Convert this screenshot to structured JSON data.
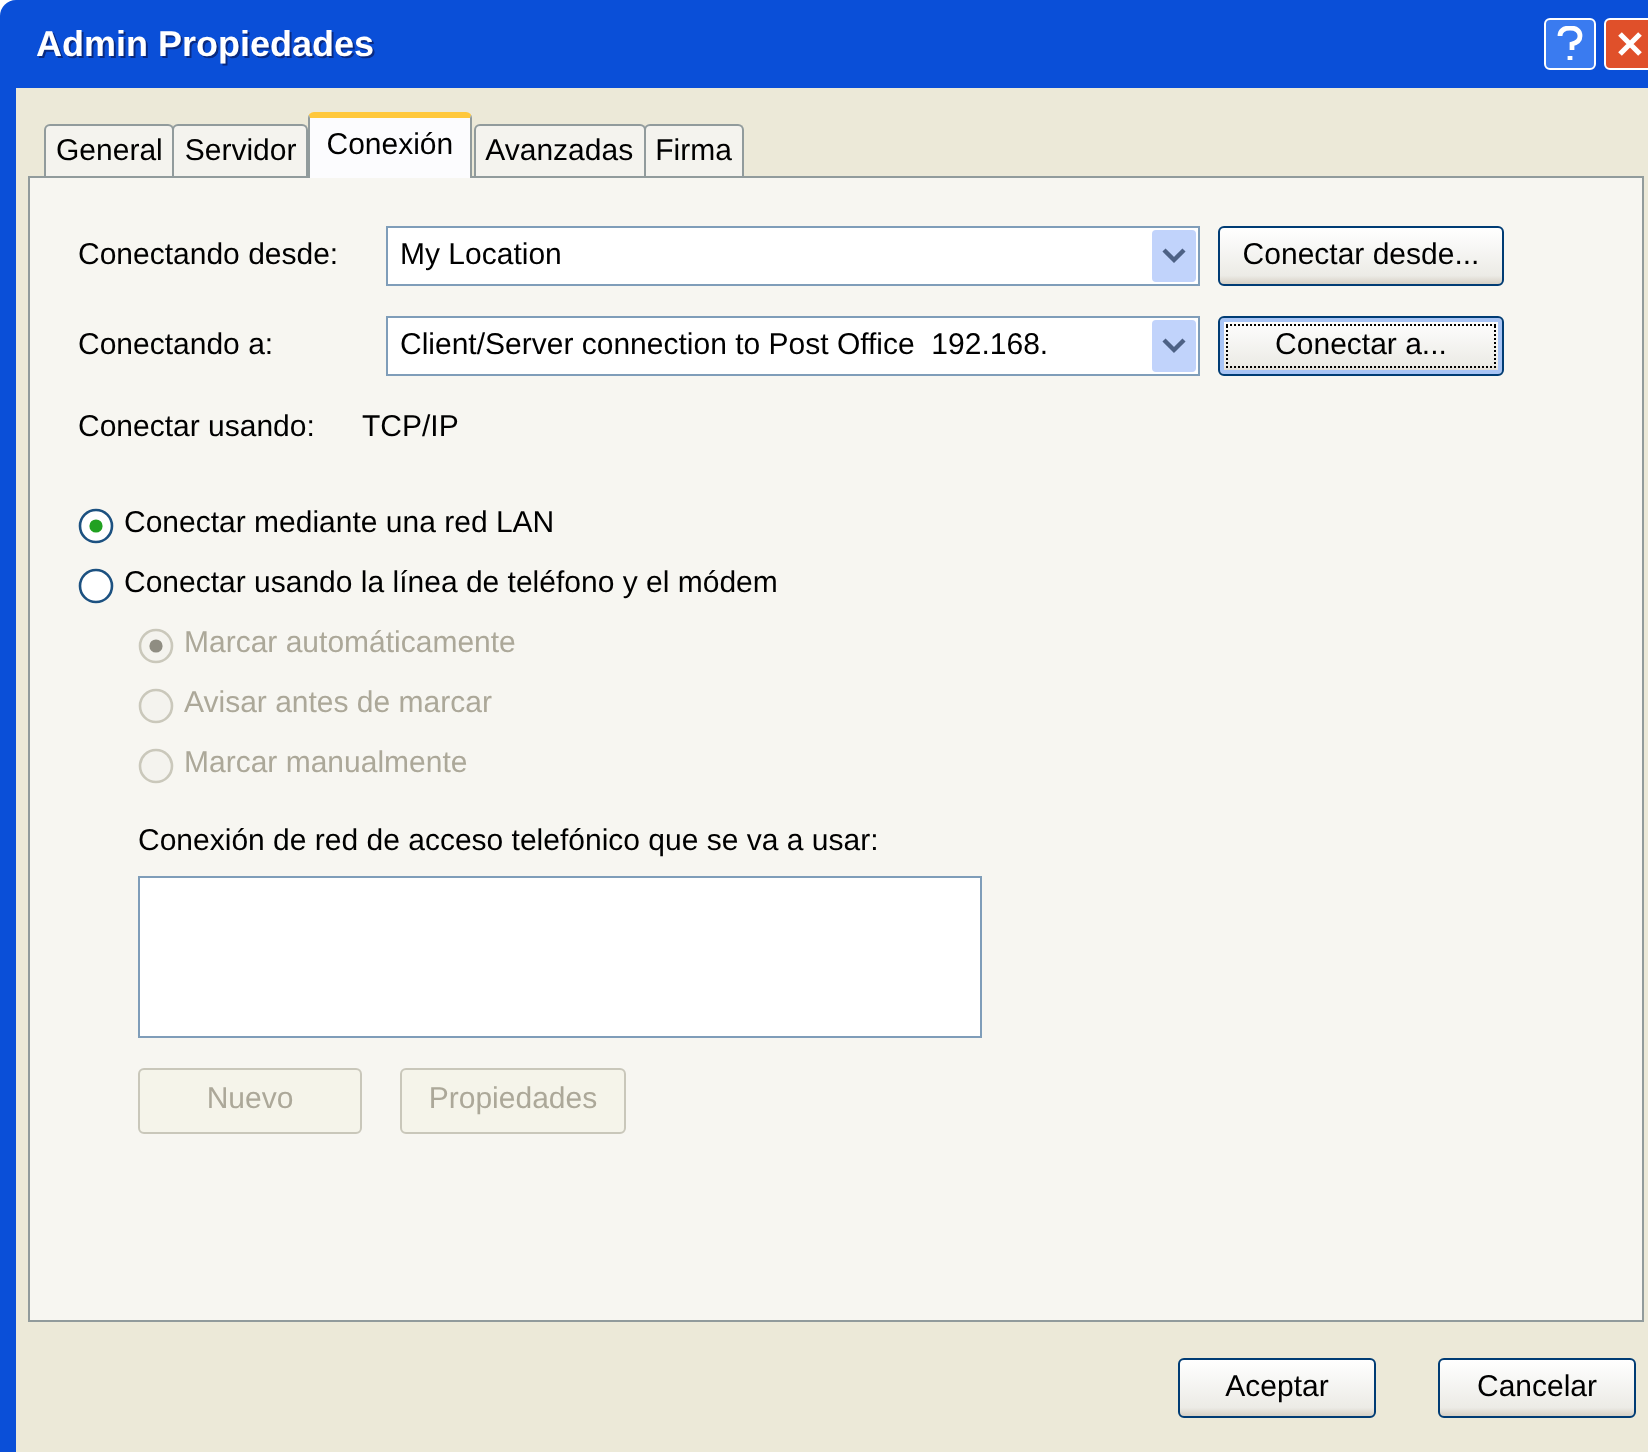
{
  "window": {
    "title": "Admin Propiedades"
  },
  "tabs": [
    {
      "label": "General",
      "selected": false
    },
    {
      "label": "Servidor",
      "selected": false
    },
    {
      "label": "Conexión",
      "selected": true
    },
    {
      "label": "Avanzadas",
      "selected": false
    },
    {
      "label": "Firma",
      "selected": false
    }
  ],
  "connection_rows": [
    {
      "label": "Conectando desde:",
      "value": "My Location",
      "button": {
        "label": "Conectar desde...",
        "focused": false
      }
    },
    {
      "label": "Conectando a:",
      "value": "Client/Server connection to Post Office  192.168.",
      "button": {
        "label": "Conectar a...",
        "focused": true
      }
    }
  ],
  "connect_using": {
    "label": "Conectar usando:",
    "value": "TCP/IP"
  },
  "radios": [
    {
      "label": "Conectar mediante una red LAN",
      "selected": true,
      "disabled": false
    },
    {
      "label": "Conectar usando la línea de teléfono y el módem",
      "selected": false,
      "disabled": false,
      "children": [
        {
          "label": "Marcar automáticamente",
          "selected": true,
          "disabled": true
        },
        {
          "label": "Avisar antes de marcar",
          "selected": false,
          "disabled": true
        },
        {
          "label": "Marcar manualmente",
          "selected": false,
          "disabled": true
        }
      ]
    }
  ],
  "dialup": {
    "label": "Conexión de red de acceso telefónico que se va a usar:",
    "buttons": [
      {
        "label": "Nuevo",
        "disabled": true
      },
      {
        "label": "Propiedades",
        "disabled": true
      }
    ]
  },
  "footer_buttons": [
    {
      "label": "Aceptar"
    },
    {
      "label": "Cancelar"
    }
  ]
}
